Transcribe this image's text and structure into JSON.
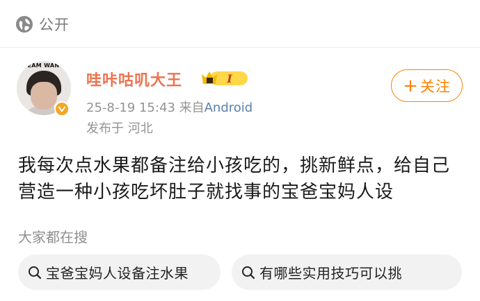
{
  "privacy": {
    "label": "公开",
    "icon": "globe-icon"
  },
  "post": {
    "avatar_text": "TEAM WANG",
    "username": "哇咔咕叽大王",
    "badge": "I",
    "timestamp": "25-8-19 15:43",
    "source_prefix": "来自",
    "source": "Android",
    "location": "发布于 河北",
    "follow_label": "关注",
    "follow_plus": "+",
    "content": "我每次点水果都备注给小孩吃的，挑新鲜点，给自己营造一种小孩吃坏肚子就找事的宝爸宝妈人设"
  },
  "hot_search": {
    "title": "大家都在搜",
    "items": [
      {
        "label": "宝爸宝妈人设备注水果"
      },
      {
        "label": "有哪些实用技巧可以挑"
      }
    ]
  },
  "colors": {
    "username": "#eb7350",
    "follow": "#ff8200",
    "link": "#5b7fad",
    "muted": "#939393",
    "chip_bg": "#f2f2f2"
  }
}
